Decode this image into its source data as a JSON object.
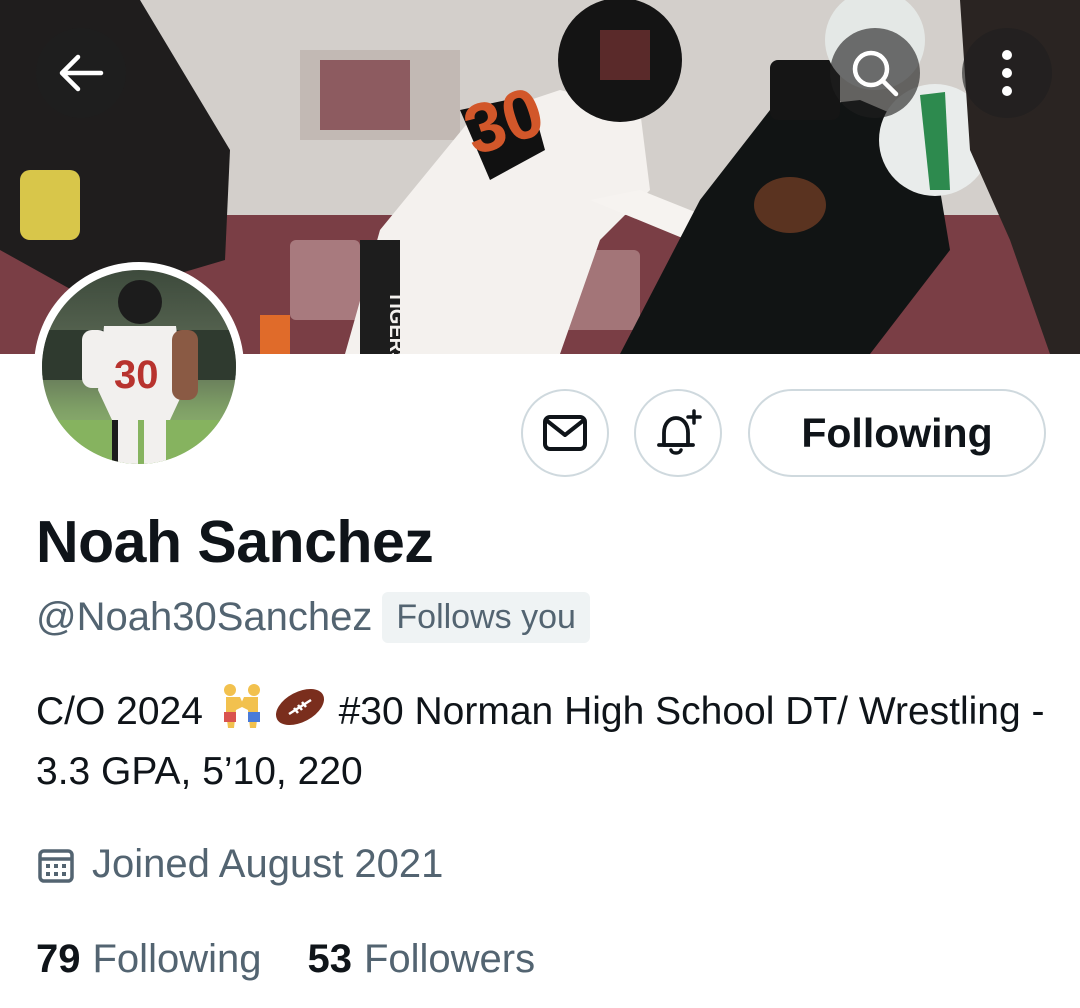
{
  "header": {
    "back_icon": "arrow-left-icon",
    "search_icon": "search-icon",
    "more_icon": "more-vertical-icon",
    "banner_jersey_text": "TIGERS",
    "banner_number": "30"
  },
  "avatar": {
    "jersey_number": "30"
  },
  "actions": {
    "message_icon": "envelope-icon",
    "notify_icon": "bell-plus-icon",
    "follow_label": "Following"
  },
  "profile": {
    "name": "Noah Sanchez",
    "handle": "@Noah30Sanchez",
    "follows_you": "Follows you",
    "bio_start": "C/O 2024",
    "bio_emoji": [
      "wrestlers-emoji",
      "american-football-emoji"
    ],
    "bio_rest": " #30 Norman High School DT/ Wrestling - 3.3 GPA, 5’10, 220",
    "joined": "Joined August 2021",
    "joined_icon": "calendar-icon"
  },
  "stats": {
    "following_count": "79",
    "following_label": "Following",
    "followers_count": "53",
    "followers_label": "Followers"
  }
}
